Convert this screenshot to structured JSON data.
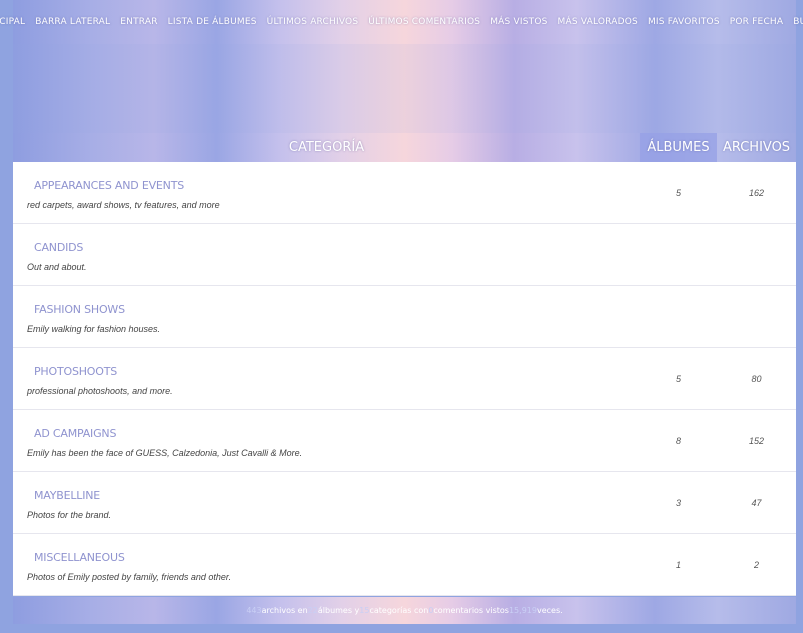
{
  "nav": {
    "items": [
      "PRINCIPAL",
      "BARRA LATERAL",
      "ENTRAR",
      "LISTA DE ÁLBUMES",
      "ÚLTIMOS ARCHIVOS",
      "ÚLTIMOS COMENTARIOS",
      "MÁS VISTOS",
      "MÁS VALORADOS",
      "MIS FAVORITOS",
      "POR FECHA",
      "BUSCAR"
    ]
  },
  "table": {
    "headers": {
      "category": "CATEGORÍA",
      "albums": "ÁLBUMES",
      "files": "ARCHIVOS"
    },
    "rows": [
      {
        "title": "APPEARANCES AND EVENTS",
        "desc": "red carpets, award shows, tv features, and more",
        "albums": "5",
        "files": "162"
      },
      {
        "title": "CANDIDS",
        "desc": "Out and about.",
        "albums": "",
        "files": ""
      },
      {
        "title": "FASHION SHOWS",
        "desc": "Emily walking for fashion houses.",
        "albums": "",
        "files": ""
      },
      {
        "title": "PHOTOSHOOTS",
        "desc": "professional photoshoots, and more.",
        "albums": "5",
        "files": "80"
      },
      {
        "title": "AD CAMPAIGNS",
        "desc": "Emily has been the face of GUESS, Calzedonia, Just Cavalli & More.",
        "albums": "8",
        "files": "152"
      },
      {
        "title": "MAYBELLINE",
        "desc": "Photos for the brand.",
        "albums": "3",
        "files": "47"
      },
      {
        "title": "MISCELLANEOUS",
        "desc": "Photos of Emily posted by family, friends and other.",
        "albums": "1",
        "files": "2"
      }
    ]
  },
  "footer": {
    "files_count": "443",
    "t1": " archivos en ",
    "albums_count": "22",
    "t2": " álbumes y ",
    "categories_count": "15",
    "t3": " categorías con ",
    "comments_count": "0",
    "t4": " comentarios vistos ",
    "views_count": "15,919",
    "t5": " veces."
  }
}
